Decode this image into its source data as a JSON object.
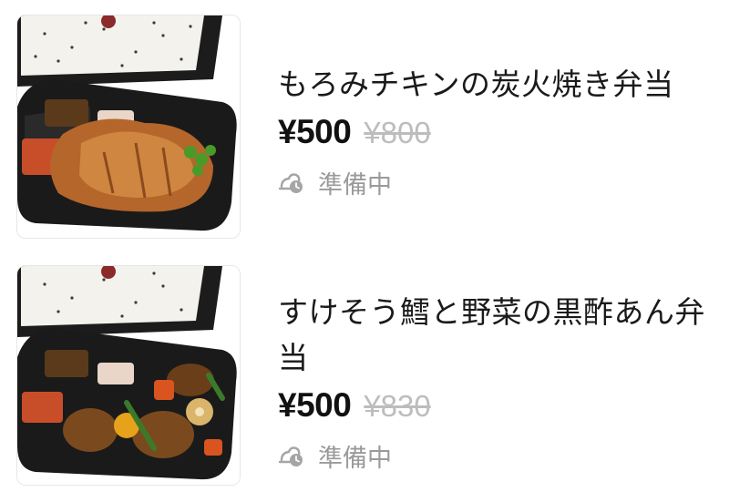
{
  "items": [
    {
      "name": "もろみチキンの炭火焼き弁当",
      "price": "¥500",
      "original_price": "¥800",
      "status": "準備中",
      "status_icon": "preparing-clock-icon"
    },
    {
      "name": "すけそう鱈と野菜の黒酢あん弁当",
      "price": "¥500",
      "original_price": "¥830",
      "status": "準備中",
      "status_icon": "preparing-clock-icon"
    }
  ],
  "colors": {
    "price": "#111111",
    "original_price": "#bdbdbd",
    "status": "#9a9a9a",
    "tray": "#1c1c1c"
  }
}
